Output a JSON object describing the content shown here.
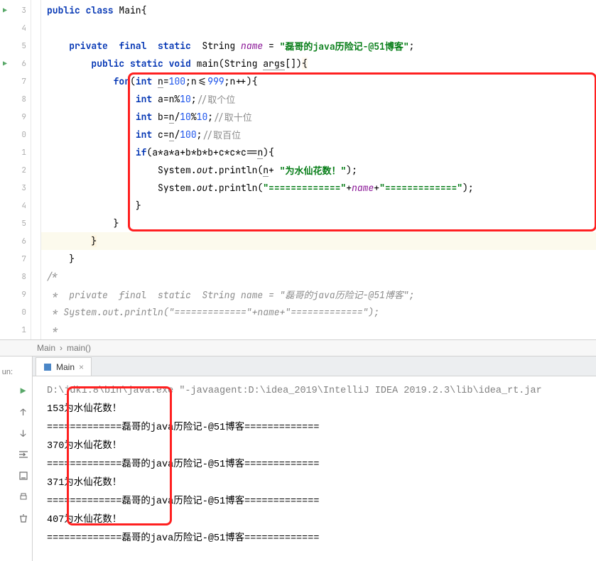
{
  "gutter": {
    "lines": [
      "3",
      "4",
      "5",
      "6",
      "7",
      "8",
      "9",
      "0",
      "1",
      "2",
      "3",
      "4",
      "5",
      "6",
      "7",
      "8",
      "9",
      "0",
      "1"
    ],
    "playRows": [
      0,
      3
    ]
  },
  "code": {
    "l3": {
      "pre": "",
      "k1": "public class",
      "cls": " Main{"
    },
    "l5": {
      "indent": "    ",
      "k1": "private  final  static  ",
      "type": "String ",
      "name": "name",
      "eq": " = ",
      "str": "\"磊哥的java历险记-@51博客\"",
      "semi": ";"
    },
    "l6": {
      "indent": "        ",
      "k1": "public static void ",
      "m": "main(String ",
      "args": "args",
      "rest": "[])",
      "brace": "{"
    },
    "l7": {
      "indent": "            ",
      "k1": "for",
      "open": "(",
      "k2": "int ",
      "v": "n",
      "eq": "=",
      "n1": "100",
      "semi": ";n<=",
      "n2": "999",
      "rest": ";n++){"
    },
    "l8": {
      "indent": "                ",
      "k1": "int ",
      "expr": "a=n%",
      "n": "10",
      "semi": ";",
      "cm": "//取个位"
    },
    "l9": {
      "indent": "                ",
      "k1": "int ",
      "expr1": "b=",
      "u": "n",
      "expr2": "/",
      "n1": "10",
      "pct": "%",
      "n2": "10",
      "semi": ";",
      "cm": "//取十位"
    },
    "l10": {
      "indent": "                ",
      "k1": "int ",
      "expr1": "c=",
      "u": "n",
      "expr2": "/",
      "n": "100",
      "semi": ";",
      "cm": "//取百位"
    },
    "l11": {
      "indent": "                ",
      "k1": "if",
      "expr": "(a*a*a+b*b*b+c*c*c==",
      "u": "n",
      "close": "){"
    },
    "l12": {
      "indent": "                    ",
      "sys": "System.",
      "out": "out",
      "dot": ".println(",
      "u": "n",
      "plus": "+ ",
      "str": "\"为水仙花数！\"",
      "close": ");"
    },
    "l13": {
      "indent": "                    ",
      "sys": "System.",
      "out": "out",
      "dot": ".println(",
      "str1": "\"=============\"",
      "plus1": "+",
      "name": "name",
      "plus2": "+",
      "str2": "\"=============\"",
      "close": ");"
    },
    "l14": {
      "indent": "                ",
      "brace": "}"
    },
    "l15": {
      "indent": "            ",
      "brace": "}"
    },
    "l16": {
      "indent": "        ",
      "brace": "}"
    },
    "l17": {
      "indent": "    ",
      "brace": "}"
    },
    "l18": {
      "cm": "/*"
    },
    "l19": {
      "cm": " *  private  final  static  String name = \"磊哥的java历险记-@51博客\";"
    },
    "l20": {
      "cm": " * System.out.println(\"=============\"+name+\"=============\");"
    },
    "l21": {
      "cm": " *"
    }
  },
  "breadcrumb": {
    "cls": "Main",
    "method": "main()"
  },
  "run": {
    "label": "un:",
    "tab": "Main",
    "cmd": "D:\\jdk1.8\\bin\\java.exe \"-javaagent:D:\\idea_2019\\IntelliJ IDEA 2019.2.3\\lib\\idea_rt.jar",
    "lines": [
      "153为水仙花数！",
      "=============磊哥的java历险记-@51博客=============",
      "370为水仙花数！",
      "=============磊哥的java历险记-@51博客=============",
      "371为水仙花数！",
      "=============磊哥的java历险记-@51博客=============",
      "407为水仙花数！",
      "=============磊哥的java历险记-@51博客============="
    ]
  }
}
